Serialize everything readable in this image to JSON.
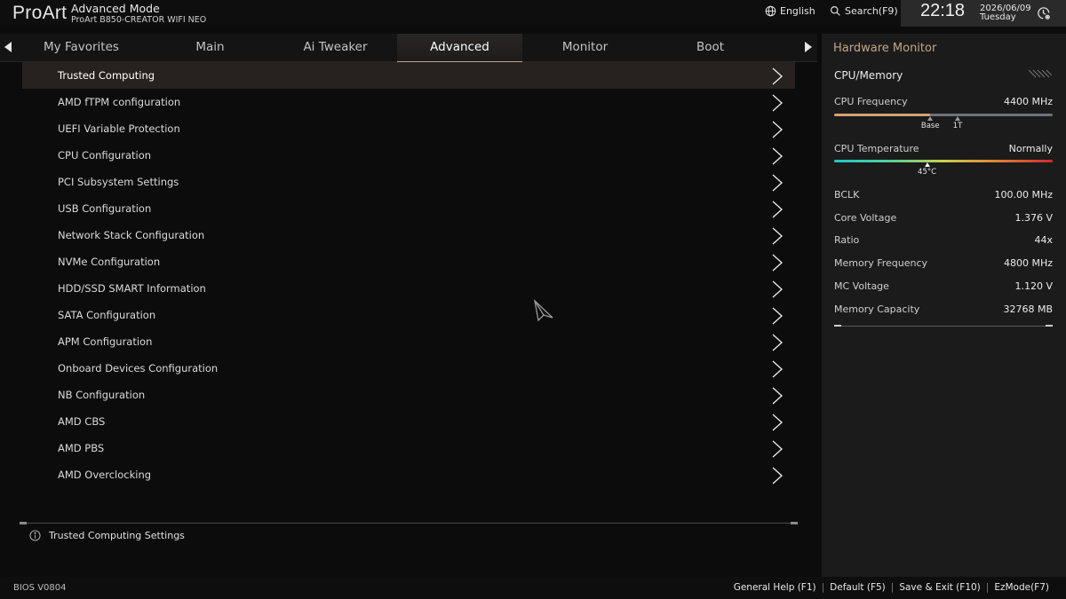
{
  "header": {
    "logo": "ProArt",
    "mode_title": "Advanced Mode",
    "board_name": "ProArt B850-CREATOR WIFI NEO",
    "language_label": "English",
    "language_icon": "globe-icon",
    "search_label": "Search(F9)",
    "search_icon": "search-icon",
    "time": "22:18",
    "date": "2026/06/09",
    "day": "Tuesday",
    "clock_settings_icon": "clock-gear-icon"
  },
  "tabs": {
    "items": [
      {
        "label": "My Favorites"
      },
      {
        "label": "Main"
      },
      {
        "label": "Ai Tweaker"
      },
      {
        "label": "Advanced"
      },
      {
        "label": "Monitor"
      },
      {
        "label": "Boot"
      }
    ],
    "active_index": 3,
    "prev_icon": "triangle-left-icon",
    "next_icon": "triangle-right-icon"
  },
  "menu": {
    "selected_index": 0,
    "items": [
      {
        "label": "Trusted Computing"
      },
      {
        "label": "AMD fTPM configuration"
      },
      {
        "label": "UEFI Variable Protection"
      },
      {
        "label": "CPU Configuration"
      },
      {
        "label": "PCI Subsystem Settings"
      },
      {
        "label": "USB Configuration"
      },
      {
        "label": "Network Stack Configuration"
      },
      {
        "label": "NVMe Configuration"
      },
      {
        "label": "HDD/SSD SMART Information"
      },
      {
        "label": "SATA Configuration"
      },
      {
        "label": "APM Configuration"
      },
      {
        "label": "Onboard Devices Configuration"
      },
      {
        "label": "NB Configuration"
      },
      {
        "label": "AMD CBS"
      },
      {
        "label": "AMD PBS"
      },
      {
        "label": "AMD Overclocking"
      }
    ]
  },
  "help": {
    "icon": "info-icon",
    "text": "Trusted Computing Settings"
  },
  "hw_monitor": {
    "title": "Hardware Monitor",
    "section": "CPU/Memory",
    "cpu_frequency": {
      "label": "CPU Frequency",
      "value": "4400 MHz",
      "fill_fraction": 0.44,
      "markers": [
        {
          "label": "Base",
          "fraction": 0.44
        },
        {
          "label": "1T",
          "fraction": 0.565
        }
      ]
    },
    "cpu_temperature": {
      "label": "CPU Temperature",
      "value": "Normally",
      "marker_label": "45°C",
      "marker_fraction": 0.425
    },
    "rows": [
      {
        "label": "BCLK",
        "value": "100.00 MHz"
      },
      {
        "label": "Core Voltage",
        "value": "1.376 V"
      },
      {
        "label": "Ratio",
        "value": "44x"
      },
      {
        "label": "Memory Frequency",
        "value": "4800 MHz"
      },
      {
        "label": "MC Voltage",
        "value": "1.120 V"
      },
      {
        "label": "Memory Capacity",
        "value": "32768 MB"
      }
    ]
  },
  "footer": {
    "bios_version": "BIOS V0804",
    "actions": [
      {
        "label": "General Help (F1)"
      },
      {
        "label": "Default (F5)"
      },
      {
        "label": "Save & Exit (F10)"
      },
      {
        "label": "EzMode(F7)"
      }
    ]
  },
  "colors": {
    "accent": "#c7a27e",
    "panel_bg": "#1b1b1b",
    "selected_row": "#272220"
  }
}
